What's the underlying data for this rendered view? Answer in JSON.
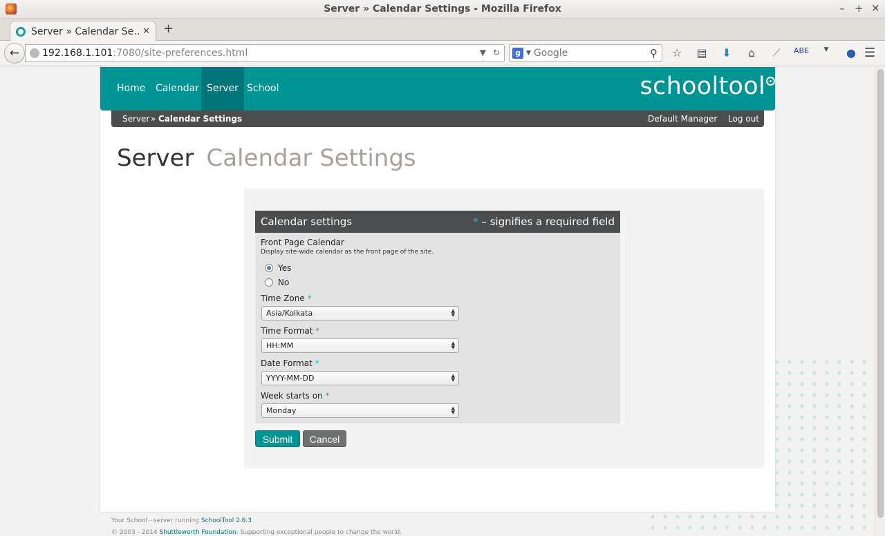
{
  "window": {
    "title": "Server » Calendar Settings - Mozilla Firefox",
    "controls": [
      "–",
      "+",
      "✕"
    ]
  },
  "tab": {
    "title": "Server » Calendar Se…",
    "close": "✕",
    "new_tab": "+"
  },
  "urlbar": {
    "host": "192.168.1.101",
    "path": ":7080/site-preferences.html"
  },
  "search": {
    "placeholder": "Google",
    "engine_letter": "g"
  },
  "toolbar_icons": [
    "star-icon",
    "reading-list-icon",
    "download-icon",
    "home-icon",
    "feather-icon",
    "abe-icon",
    "dropdown-icon",
    "blue-globe-icon"
  ],
  "nav": {
    "items": [
      {
        "label": "Home"
      },
      {
        "label": "Calendar"
      },
      {
        "label": "Server",
        "active": true
      },
      {
        "label": "School"
      }
    ],
    "brand": "schooltool"
  },
  "breadcrumb": {
    "parent": "Server",
    "separator": "»",
    "current": "Calendar Settings"
  },
  "user_menu": {
    "user": "Default Manager",
    "logout": "Log out"
  },
  "page_title": {
    "main": "Server",
    "sub": "Calendar Settings"
  },
  "form": {
    "title": "Calendar settings",
    "required_star": "*",
    "required_note": "– signifies a required field",
    "front_page": {
      "label": "Front Page Calendar",
      "description": "Display site-wide calendar as the front page of the site.",
      "options": [
        {
          "label": "Yes",
          "checked": true
        },
        {
          "label": "No",
          "checked": false
        }
      ]
    },
    "timezone": {
      "label": "Time Zone",
      "value": "Asia/Kolkata"
    },
    "time_format": {
      "label": "Time Format",
      "value": "HH:MM"
    },
    "date_format": {
      "label": "Date Format",
      "value": "YYYY-MM-DD"
    },
    "week_start": {
      "label": "Week starts on",
      "value": "Monday"
    },
    "submit": "Submit",
    "cancel": "Cancel"
  },
  "footer": {
    "line1_prefix": "Your School - server running ",
    "line1_link": "SchoolTool 2.6.3",
    "line2_prefix": "© 2003 - 2014 ",
    "line2_link": "Shuttleworth Foundation",
    "line2_suffix": ": Supporting exceptional people to change the world."
  },
  "colors": {
    "teal": "#009495",
    "dark_teal": "#00767a",
    "dark_gray": "#4b4d4e"
  }
}
